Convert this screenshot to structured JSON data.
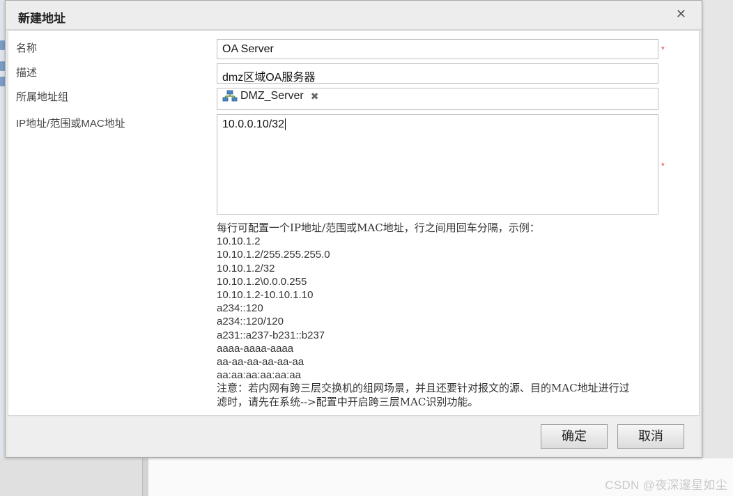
{
  "dialog": {
    "title": "新建地址",
    "close_glyph": "✕",
    "name_label": "名称",
    "name_value": "OA Server",
    "desc_label": "描述",
    "desc_value": "dmz区域OA服务器",
    "group_label": "所属地址组",
    "group_tag": "DMZ_Server",
    "tag_remove": "✖",
    "ip_label": "IP地址/范围或MAC地址",
    "ip_value": "10.0.0.10/32",
    "required_mark": "*",
    "help_intro": "每行可配置一个IP地址/范围或MAC地址，行之间用回车分隔，示例：",
    "examples": [
      "10.10.1.2",
      "10.10.1.2/255.255.255.0",
      "10.10.1.2/32",
      "10.10.1.2\\0.0.0.255",
      "10.10.1.2-10.10.1.10",
      "a234::120",
      "a234::120/120",
      "a231::a237-b231::b237",
      "aaaa-aaaa-aaaa",
      "aa-aa-aa-aa-aa-aa",
      "aa:aa:aa:aa:aa:aa"
    ],
    "note_line1": "注意：若内网有跨三层交换机的组网场景，并且还要针对报文的源、目的MAC地址进行过",
    "note_line2": "滤时，请先在系统-->配置中开启跨三层MAC识别功能。",
    "ok_label": "确定",
    "cancel_label": "取消"
  },
  "watermark": "CSDN @夜深邃星如尘",
  "icons": {
    "group_tag_icon": "network-group-icon",
    "close": "close-icon"
  }
}
